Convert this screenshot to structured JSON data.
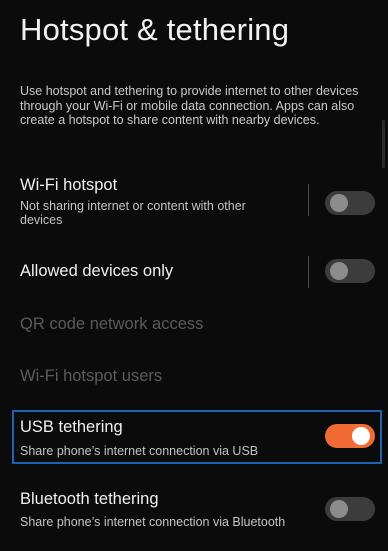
{
  "page": {
    "title": "Hotspot & tethering",
    "description": "Use hotspot and tethering to provide internet to other devices through your Wi-Fi or mobile data connection. Apps can also create a hotspot to share content with nearby devices."
  },
  "settings": {
    "wifi_hotspot": {
      "title": "Wi-Fi hotspot",
      "subtitle": "Not sharing internet or content with other devices",
      "enabled": false
    },
    "allowed_devices_only": {
      "title": "Allowed devices only",
      "enabled": false
    },
    "qr_code": {
      "title": "QR code network access"
    },
    "hotspot_users": {
      "title": "Wi-Fi hotspot users"
    },
    "usb_tethering": {
      "title": "USB tethering",
      "subtitle": "Share phone’s internet connection via USB",
      "enabled": true
    },
    "bluetooth_tethering": {
      "title": "Bluetooth tethering",
      "subtitle": "Share phone’s internet connection via Bluetooth",
      "enabled": false
    }
  },
  "colors": {
    "accent": "#f26b35",
    "focus_outline": "#1d63b5",
    "background": "#0b0b0b"
  }
}
